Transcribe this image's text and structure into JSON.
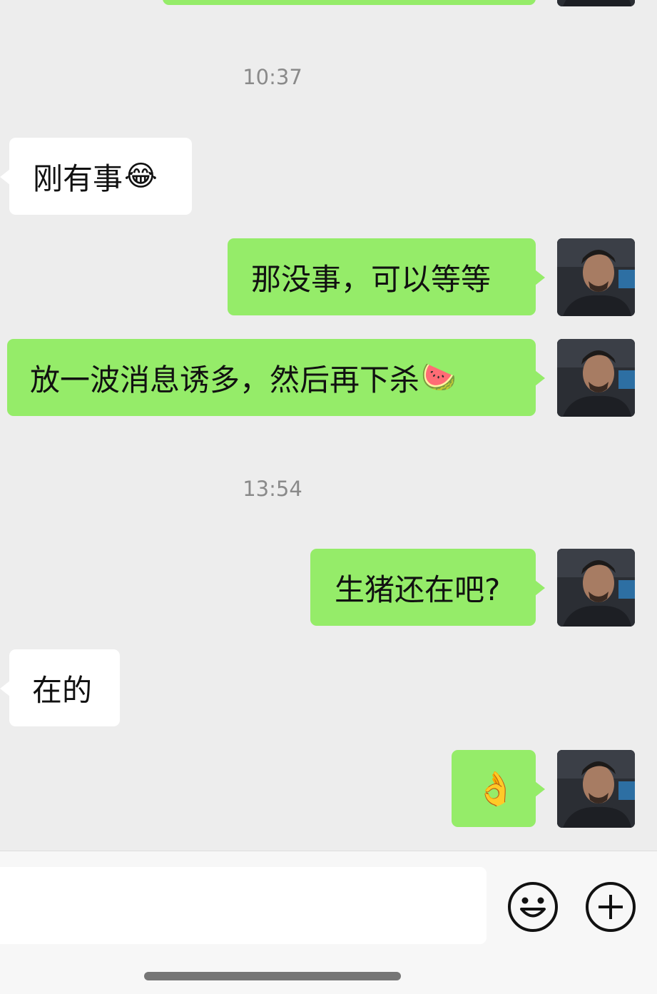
{
  "colors": {
    "background": "#ededed",
    "outgoing_bubble": "#95ec69",
    "incoming_bubble": "#ffffff",
    "timestamp_text": "#8a8a8a"
  },
  "top_fragment": {
    "direction": "outgoing"
  },
  "timestamps": [
    "10:37",
    "13:54"
  ],
  "messages": [
    {
      "direction": "incoming",
      "text": "刚有事",
      "emoji": "😂",
      "emoji_name": "tears-of-joy-emoji"
    },
    {
      "direction": "outgoing",
      "text": "那没事，可以等等",
      "emoji": ""
    },
    {
      "direction": "outgoing",
      "text": "放一波消息诱多，然后再下杀",
      "emoji": "🍉",
      "emoji_name": "eating-watermelon-emoji"
    },
    {
      "direction": "outgoing",
      "text": "生猪还在吧?",
      "emoji": ""
    },
    {
      "direction": "incoming",
      "text": "在的",
      "emoji": ""
    },
    {
      "direction": "outgoing",
      "text": "",
      "emoji": "👌",
      "emoji_name": "ok-hand-emoji"
    }
  ],
  "input_bar": {
    "text_value": "",
    "emoji_button_icon": "smiley-face-icon",
    "more_button_icon": "plus-circle-icon"
  }
}
